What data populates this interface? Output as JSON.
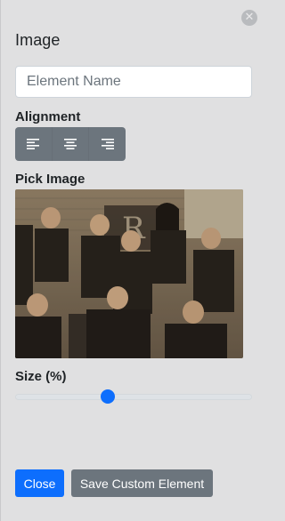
{
  "panel": {
    "title": "Image",
    "close_icon": "times-circle-icon"
  },
  "name_field": {
    "value": "",
    "placeholder": "Element Name"
  },
  "alignment": {
    "label": "Alignment",
    "options": [
      {
        "icon": "align-left-icon"
      },
      {
        "icon": "align-center-icon"
      },
      {
        "icon": "align-right-icon"
      }
    ]
  },
  "pick_image": {
    "label": "Pick Image",
    "image": "group-photo-sepia"
  },
  "size": {
    "label": "Size (%)",
    "value_fraction": 0.39
  },
  "footer": {
    "close_label": "Close",
    "save_label": "Save Custom Element"
  },
  "colors": {
    "primary": "#0d6efd",
    "secondary": "#6c757d",
    "panel_bg": "#e0e0e1"
  }
}
